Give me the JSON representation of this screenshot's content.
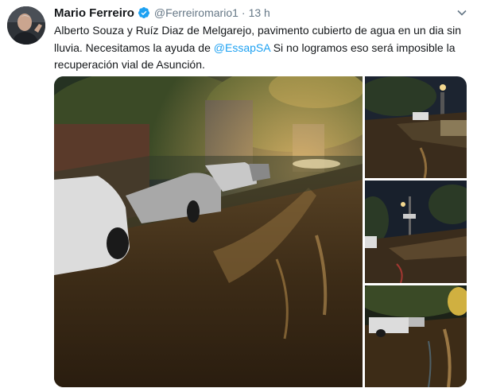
{
  "author": {
    "name": "Mario Ferreiro",
    "handle": "@Ferreiromario1",
    "separator": "·",
    "time": "13 h",
    "verified_icon": "verified-badge-icon",
    "avatar_icon": "profile-avatar"
  },
  "tweet": {
    "text_part1": "Alberto Souza y Ruíz Diaz de Melgarejo, pavimento cubierto de agua en un dia sin lluvia. Necesitamos la ayuda de ",
    "mention": "@EssapSA",
    "text_part2": " Si no logramos eso será imposible la recuperación vial de Asunción."
  },
  "media": {
    "count": 4,
    "photos": [
      "flooded-street-main-photo",
      "flooded-street-photo-2",
      "flooded-street-photo-3",
      "flooded-street-photo-4"
    ]
  },
  "colors": {
    "link": "#1da1f2",
    "secondary_text": "#657786",
    "verified": "#1da1f2"
  }
}
